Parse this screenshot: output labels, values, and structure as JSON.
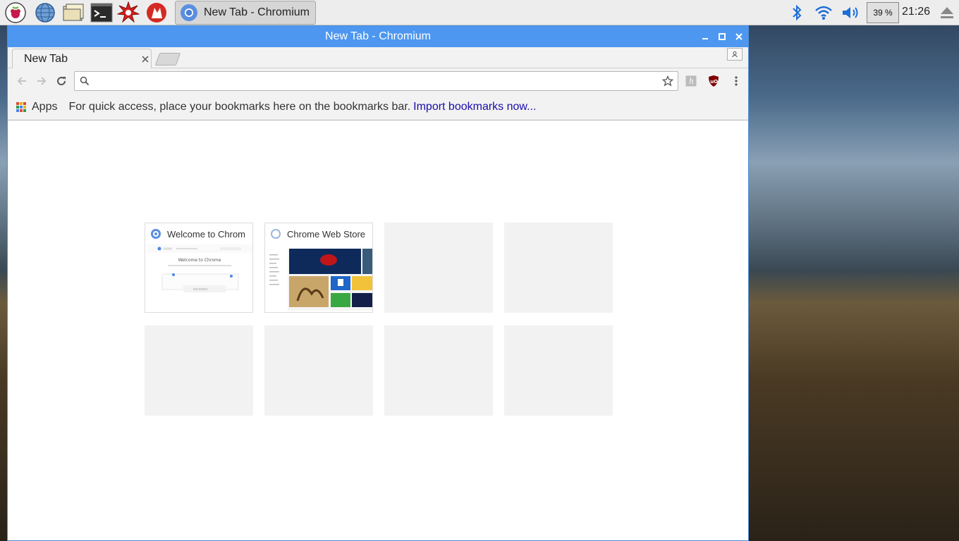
{
  "taskbar": {
    "launchers": [
      {
        "name": "raspberry-menu-icon"
      },
      {
        "name": "web-browser-icon"
      },
      {
        "name": "file-manager-icon"
      },
      {
        "name": "terminal-icon"
      },
      {
        "name": "math-kernel-icon"
      },
      {
        "name": "wolfram-icon"
      }
    ],
    "task_title": "New Tab - Chromium",
    "cpu_label": "39 %",
    "clock": "21:26"
  },
  "window": {
    "title": "New Tab - Chromium",
    "tab_label": "New Tab",
    "omnibox_placeholder": "",
    "bookmarks": {
      "apps_label": "Apps",
      "message": "For quick access, place your bookmarks here on the bookmarks bar.",
      "import_link": "Import bookmarks now..."
    }
  },
  "tiles": [
    {
      "title": "Welcome to Chrom",
      "filled": true
    },
    {
      "title": "Chrome Web Store",
      "filled": true
    },
    {
      "title": "",
      "filled": false
    },
    {
      "title": "",
      "filled": false
    },
    {
      "title": "",
      "filled": false
    },
    {
      "title": "",
      "filled": false
    },
    {
      "title": "",
      "filled": false
    },
    {
      "title": "",
      "filled": false
    }
  ],
  "welcome_thumb": {
    "heading": "Welcome to Chrome",
    "button": "Get started"
  },
  "colors": {
    "titlebar": "#4d97f0",
    "link": "#1a0dab",
    "tile_empty": "#f2f2f2"
  }
}
